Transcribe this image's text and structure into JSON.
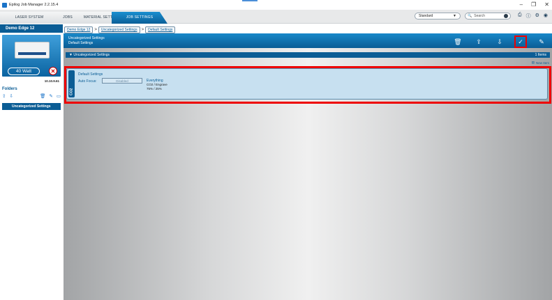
{
  "window": {
    "title": "Epilog Job Manager 2.2.15.4",
    "controls": [
      "–",
      "❐",
      "✕"
    ]
  },
  "tabs": [
    {
      "label": "LASER SYSTEM",
      "active": false
    },
    {
      "label": "JOBS",
      "active": false
    },
    {
      "label": "MATERIAL SETTINGS",
      "active": false
    },
    {
      "label": "JOB SETTINGS",
      "active": true
    }
  ],
  "toolbar": {
    "mode": "Standard",
    "search_placeholder": "Search"
  },
  "machine": {
    "name": "Demo Edge 12",
    "wattage": "40 Watt",
    "ip": "10.10.9.61"
  },
  "folders": {
    "title": "Folders",
    "items": [
      "Uncategorized Settings"
    ]
  },
  "breadcrumb": [
    "Demo Edge 12",
    "Uncategorized Settings",
    "Default Settings"
  ],
  "header": {
    "line1": "Uncategorized Settings",
    "line2": "Default Settings"
  },
  "group": {
    "name": "Uncategorized Settings",
    "count": "1 Items",
    "new_item": "New Item"
  },
  "setting": {
    "title": "Default Settings",
    "type": "CO2",
    "autofocus_label": "Auto Focus:",
    "autofocus_value": "Disabled",
    "process": "Everything",
    "mode": "CO2 / Engrave",
    "power_speed": "75% / 25%"
  },
  "colors": {
    "accent": "#0b5d95",
    "highlight": "#e00000"
  }
}
